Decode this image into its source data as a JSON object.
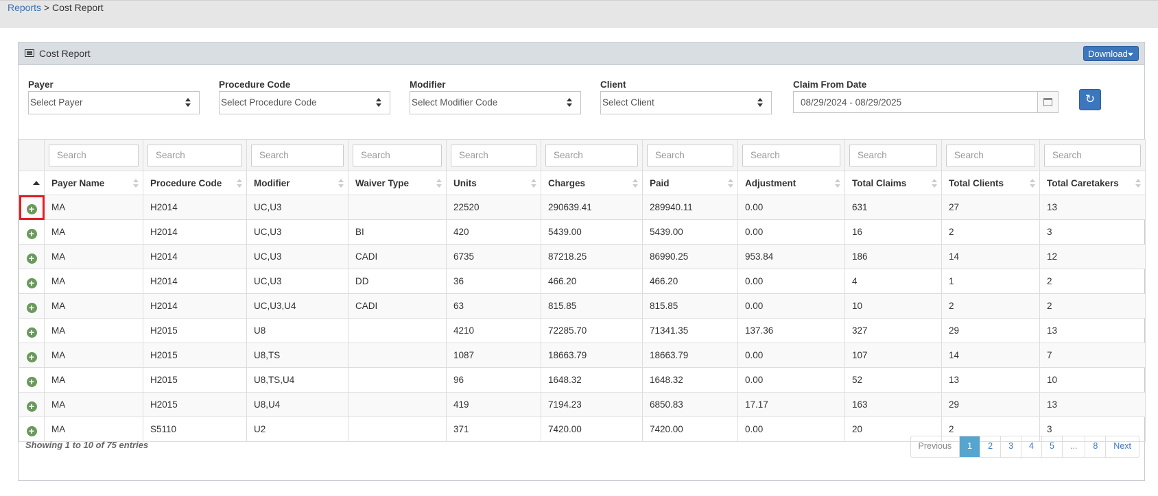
{
  "breadcrumb": {
    "parent": "Reports",
    "separator": " > ",
    "current": "Cost Report"
  },
  "panel": {
    "title": "Cost Report",
    "download_label": "Download"
  },
  "filters": {
    "payer": {
      "label": "Payer",
      "value": "Select Payer"
    },
    "procedure": {
      "label": "Procedure Code",
      "value": "Select Procedure Code"
    },
    "modifier": {
      "label": "Modifier",
      "value": "Select Modifier Code"
    },
    "client": {
      "label": "Client",
      "value": "Select Client"
    },
    "claim_date": {
      "label": "Claim From Date",
      "value": "08/29/2024 - 08/29/2025"
    }
  },
  "search_placeholder": "Search",
  "columns": [
    "Payer Name",
    "Procedure Code",
    "Modifier",
    "Waiver Type",
    "Units",
    "Charges",
    "Paid",
    "Adjustment",
    "Total Claims",
    "Total Clients",
    "Total Caretakers"
  ],
  "rows": [
    [
      "MA",
      "H2014",
      "UC,U3",
      "",
      "22520",
      "290639.41",
      "289940.11",
      "0.00",
      "631",
      "27",
      "13"
    ],
    [
      "MA",
      "H2014",
      "UC,U3",
      "BI",
      "420",
      "5439.00",
      "5439.00",
      "0.00",
      "16",
      "2",
      "3"
    ],
    [
      "MA",
      "H2014",
      "UC,U3",
      "CADI",
      "6735",
      "87218.25",
      "86990.25",
      "953.84",
      "186",
      "14",
      "12"
    ],
    [
      "MA",
      "H2014",
      "UC,U3",
      "DD",
      "36",
      "466.20",
      "466.20",
      "0.00",
      "4",
      "1",
      "2"
    ],
    [
      "MA",
      "H2014",
      "UC,U3,U4",
      "CADI",
      "63",
      "815.85",
      "815.85",
      "0.00",
      "10",
      "2",
      "2"
    ],
    [
      "MA",
      "H2015",
      "U8",
      "",
      "4210",
      "72285.70",
      "71341.35",
      "137.36",
      "327",
      "29",
      "13"
    ],
    [
      "MA",
      "H2015",
      "U8,TS",
      "",
      "1087",
      "18663.79",
      "18663.79",
      "0.00",
      "107",
      "14",
      "7"
    ],
    [
      "MA",
      "H2015",
      "U8,TS,U4",
      "",
      "96",
      "1648.32",
      "1648.32",
      "0.00",
      "52",
      "13",
      "10"
    ],
    [
      "MA",
      "H2015",
      "U8,U4",
      "",
      "419",
      "7194.23",
      "6850.83",
      "17.17",
      "163",
      "29",
      "13"
    ],
    [
      "MA",
      "S5110",
      "U2",
      "",
      "371",
      "7420.00",
      "7420.00",
      "0.00",
      "20",
      "2",
      "3"
    ]
  ],
  "footer": {
    "info": "Showing 1 to 10 of 75 entries",
    "pages": [
      "Previous",
      "1",
      "2",
      "3",
      "4",
      "5",
      "...",
      "8",
      "Next"
    ],
    "active_page": "1"
  },
  "colors": {
    "accent": "#3c76bd",
    "active_page": "#55a5cf",
    "expand_icon": "#6a9a5b",
    "highlight": "#e01c24"
  }
}
